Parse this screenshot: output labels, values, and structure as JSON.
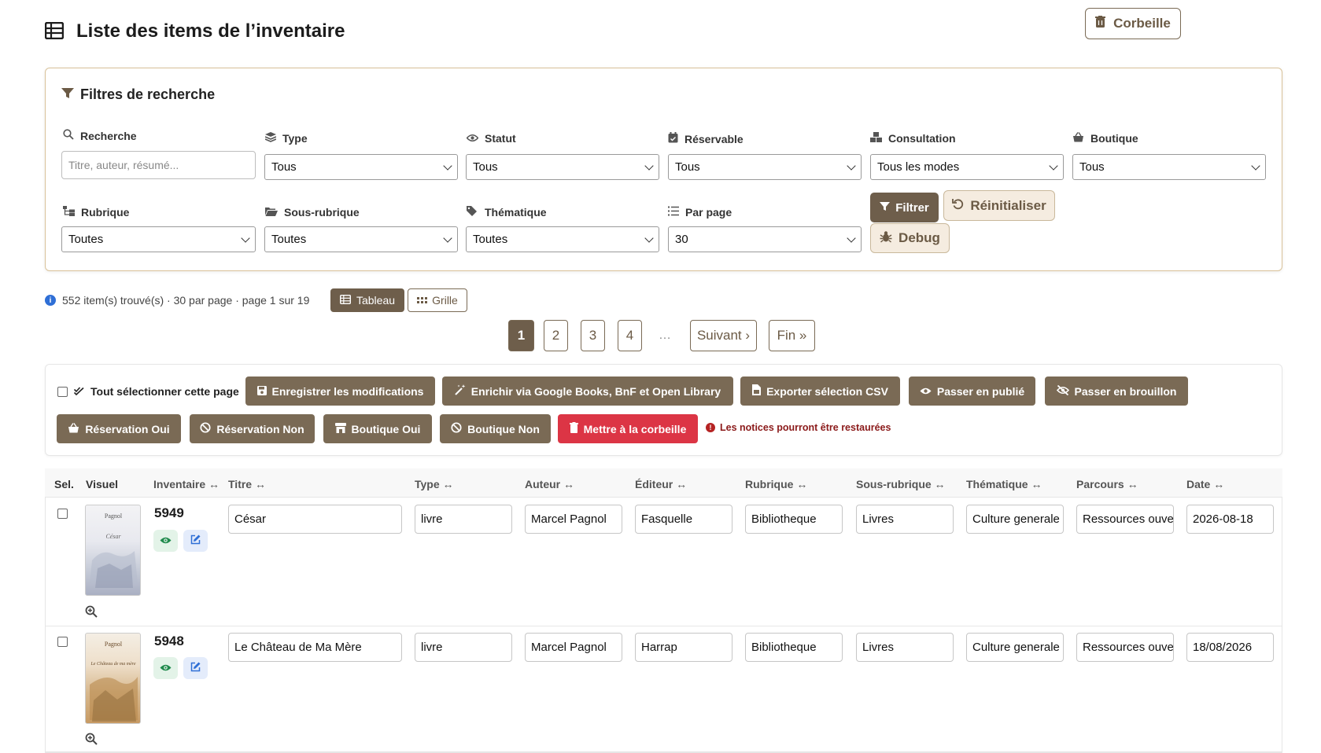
{
  "header": {
    "title": "Liste des items de l’inventaire",
    "trash_label": "Corbeille"
  },
  "filters": {
    "title": "Filtres de recherche",
    "search": {
      "label": "Recherche",
      "placeholder": "Titre, auteur, résumé..."
    },
    "type": {
      "label": "Type",
      "value": "Tous"
    },
    "statut": {
      "label": "Statut",
      "value": "Tous"
    },
    "reservable": {
      "label": "Réservable",
      "value": "Tous"
    },
    "consultation": {
      "label": "Consultation",
      "value": "Tous les modes"
    },
    "boutique": {
      "label": "Boutique",
      "value": "Tous"
    },
    "rubrique": {
      "label": "Rubrique",
      "value": "Toutes"
    },
    "sous_rubrique": {
      "label": "Sous-rubrique",
      "value": "Toutes"
    },
    "thematique": {
      "label": "Thématique",
      "value": "Toutes"
    },
    "par_page": {
      "label": "Par page",
      "value": "30"
    },
    "filter_btn": "Filtrer",
    "reset_btn": "Réinitialiser",
    "debug_btn": "Debug"
  },
  "results": {
    "summary": "552 item(s) trouvé(s) · 30 par page · page 1 sur 19",
    "view_table": "Tableau",
    "view_grid": "Grille"
  },
  "pagination": {
    "pages": [
      "1",
      "2",
      "3",
      "4"
    ],
    "ellipsis": "…",
    "next": "Suivant ›",
    "last": "Fin »"
  },
  "bulk": {
    "select_all": "Tout sélectionner cette page",
    "save": "Enregistrer les modifications",
    "enrich": "Enrichir via Google Books, BnF et Open Library",
    "export": "Exporter sélection CSV",
    "publish": "Passer en publié",
    "draft": "Passer en brouillon",
    "reserve_yes": "Réservation Oui",
    "reserve_no": "Réservation Non",
    "shop_yes": "Boutique Oui",
    "shop_no": "Boutique Non",
    "trash": "Mettre à la corbeille",
    "warning": "Les notices pourront être restaurées"
  },
  "table": {
    "headers": {
      "sel": "Sel.",
      "visuel": "Visuel",
      "inventaire": "Inventaire ↔",
      "titre": "Titre ↔",
      "type": "Type ↔",
      "auteur": "Auteur ↔",
      "editeur": "Éditeur ↔",
      "rubrique": "Rubrique ↔",
      "sous_rubrique": "Sous-rubrique ↔",
      "thematique": "Thématique ↔",
      "parcours": "Parcours ↔",
      "date": "Date ↔"
    },
    "rows": [
      {
        "inventaire": "5949",
        "titre": "César",
        "type": "livre",
        "auteur": "Marcel Pagnol",
        "editeur": "Fasquelle",
        "rubrique": "Bibliotheque",
        "sous_rubrique": "Livres",
        "thematique": "Culture generale",
        "parcours": "Ressources ouve",
        "date": "2026-08-18",
        "cover_author": "Pagnol",
        "cover_title": "César"
      },
      {
        "inventaire": "5948",
        "titre": "Le Château de Ma Mère",
        "type": "livre",
        "auteur": "Marcel Pagnol",
        "editeur": "Harrap",
        "rubrique": "Bibliotheque",
        "sous_rubrique": "Livres",
        "thematique": "Culture generale",
        "parcours": "Ressources ouve",
        "date": "18/08/2026",
        "cover_author": "Pagnol",
        "cover_title": "Le Château de ma mère"
      }
    ]
  },
  "colors": {
    "brand": "#6e5e4b",
    "danger": "#dc3545",
    "filter_border": "#d9c299"
  }
}
